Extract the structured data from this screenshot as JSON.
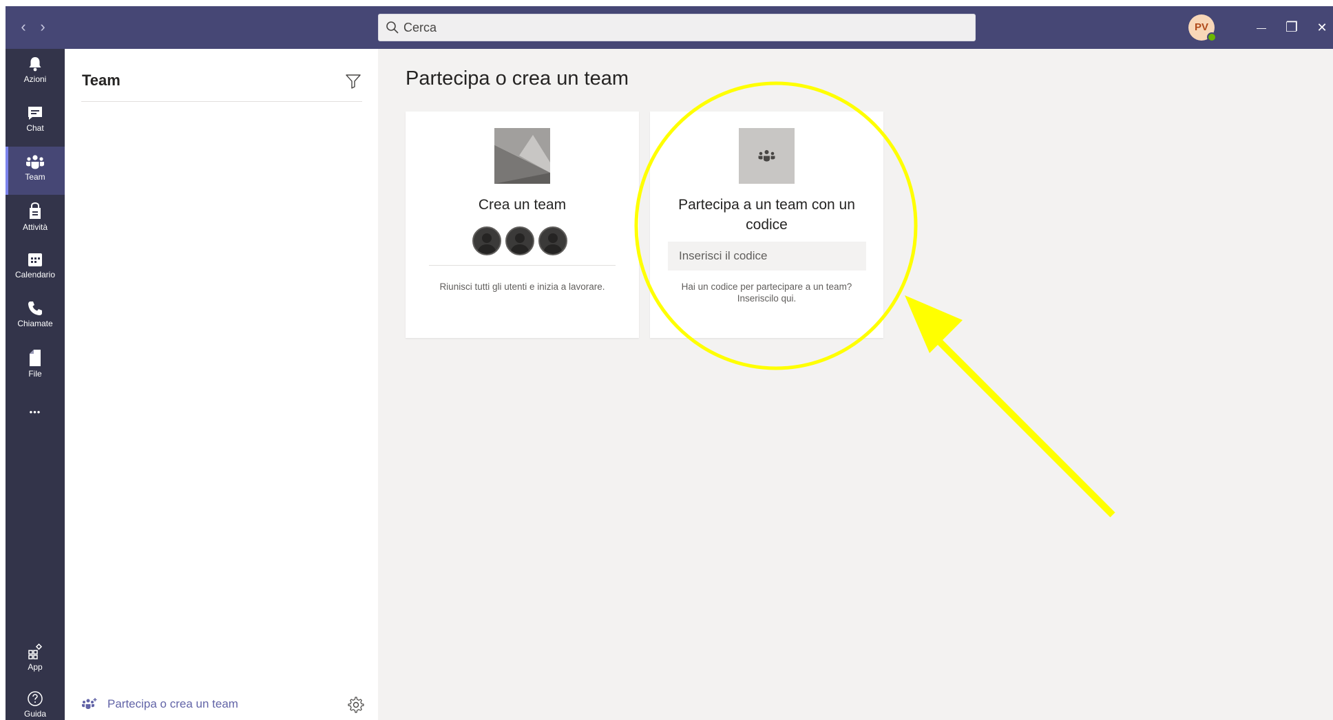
{
  "titlebar": {
    "back_glyph": "‹",
    "forward_glyph": "›",
    "search_placeholder": "Cerca",
    "avatar_initials": "PV",
    "minimize_glyph": "—",
    "restore_glyph": "❐",
    "close_glyph": "✕"
  },
  "rail": {
    "items": [
      {
        "label": "Azioni",
        "icon": "bell-icon"
      },
      {
        "label": "Chat",
        "icon": "chat-icon"
      },
      {
        "label": "Team",
        "icon": "teams-icon",
        "active": true
      },
      {
        "label": "Attività",
        "icon": "assignments-icon"
      },
      {
        "label": "Calendario",
        "icon": "calendar-icon"
      },
      {
        "label": "Chiamate",
        "icon": "phone-icon"
      },
      {
        "label": "File",
        "icon": "file-icon"
      }
    ],
    "more_glyph": "•••",
    "bottom": [
      {
        "label": "App",
        "icon": "apps-icon"
      },
      {
        "label": "Guida",
        "icon": "help-icon"
      }
    ]
  },
  "panel": {
    "title": "Team",
    "join_link_label": "Partecipa o crea un team"
  },
  "main": {
    "title": "Partecipa o crea un team",
    "create_card": {
      "title": "Crea un team",
      "description": "Riunisci tutti gli utenti e inizia a lavorare."
    },
    "join_card": {
      "title_line1": "Partecipa a un team con un",
      "title_line2": "codice",
      "input_placeholder": "Inserisci il codice",
      "description_line1": "Hai un codice per partecipare a un team?",
      "description_line2": "Inseriscilo qui."
    }
  },
  "colors": {
    "titlebar": "#464775",
    "rail": "#33344a",
    "accent": "#6264a7",
    "annotation": "#ffff00"
  }
}
